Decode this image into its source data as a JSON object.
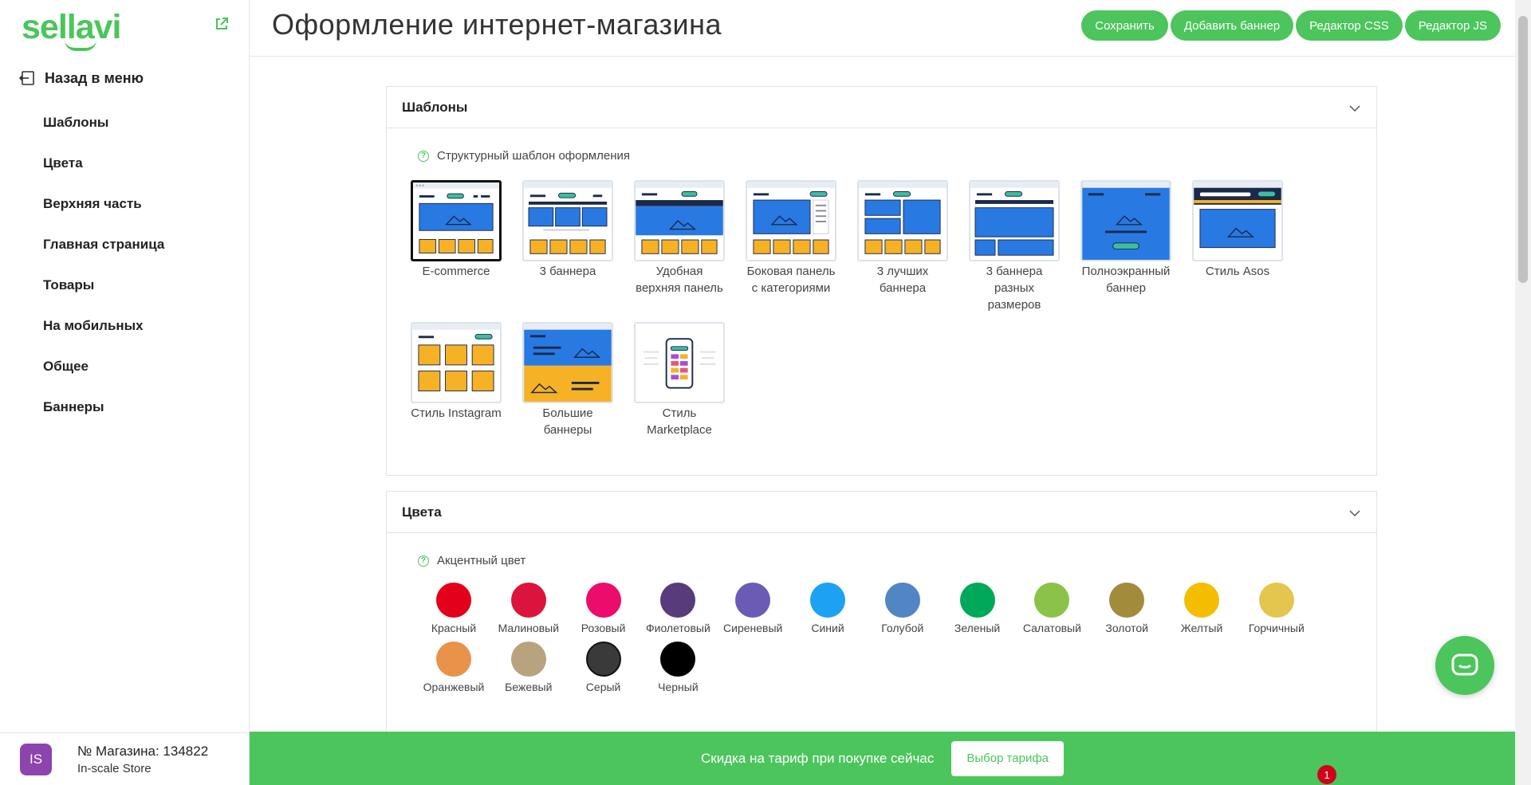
{
  "brand": {
    "logo": "sellavi",
    "accent": "#4cc55c"
  },
  "sidebar": {
    "back_label": "Назад в меню",
    "items": [
      {
        "label": "Шаблоны"
      },
      {
        "label": "Цвета"
      },
      {
        "label": "Верхняя часть"
      },
      {
        "label": "Главная страница"
      },
      {
        "label": "Товары"
      },
      {
        "label": "На мобильных"
      },
      {
        "label": "Общее"
      },
      {
        "label": "Баннеры"
      }
    ],
    "store": {
      "avatar": "IS",
      "number": "№ Магазина: 134822",
      "name": "In-scale Store"
    }
  },
  "header": {
    "title": "Оформление интернет-магазина",
    "buttons": {
      "save": "Сохранить",
      "add_banner": "Добавить баннер",
      "css": "Редактор CSS",
      "js": "Редактор JS"
    }
  },
  "templates": {
    "title": "Шаблоны",
    "hint": "Структурный шаблон оформления",
    "selected": "E-commerce",
    "items": [
      {
        "label": "E-commerce"
      },
      {
        "label": "3 баннера"
      },
      {
        "label": "Удобная верхняя панель"
      },
      {
        "label": "Боковая панель с категориями"
      },
      {
        "label": "3 лучших баннера"
      },
      {
        "label": "3 баннера разных размеров"
      },
      {
        "label": "Полноэкранный баннер"
      },
      {
        "label": "Стиль Asos"
      },
      {
        "label": "Стиль Instagram"
      },
      {
        "label": "Большие баннеры"
      },
      {
        "label": "Стиль Marketplace"
      }
    ]
  },
  "colors": {
    "title": "Цвета",
    "hint": "Акцентный цвет",
    "items": [
      {
        "label": "Красный",
        "hex": "#e2001a"
      },
      {
        "label": "Малиновый",
        "hex": "#dc143c"
      },
      {
        "label": "Розовый",
        "hex": "#ec0c6c"
      },
      {
        "label": "Фиолетовый",
        "hex": "#573b7b"
      },
      {
        "label": "Сиреневый",
        "hex": "#6b5bb5"
      },
      {
        "label": "Синий",
        "hex": "#1da1f2"
      },
      {
        "label": "Голубой",
        "hex": "#5185c3"
      },
      {
        "label": "Зеленый",
        "hex": "#00a859"
      },
      {
        "label": "Салатовый",
        "hex": "#8bc34a"
      },
      {
        "label": "Золотой",
        "hex": "#a28c3c"
      },
      {
        "label": "Желтый",
        "hex": "#f5bd00"
      },
      {
        "label": "Горчичный",
        "hex": "#e4c64e"
      },
      {
        "label": "Оранжевый",
        "hex": "#e8924a"
      },
      {
        "label": "Бежевый",
        "hex": "#b8a37e"
      },
      {
        "label": "Серый",
        "hex": "#3a3a3a"
      },
      {
        "label": "Черный",
        "hex": "#000000"
      }
    ]
  },
  "promo": {
    "text": "Скидка на тариф при покупке сейчас",
    "button": "Выбор тарифа",
    "badge": "1"
  }
}
